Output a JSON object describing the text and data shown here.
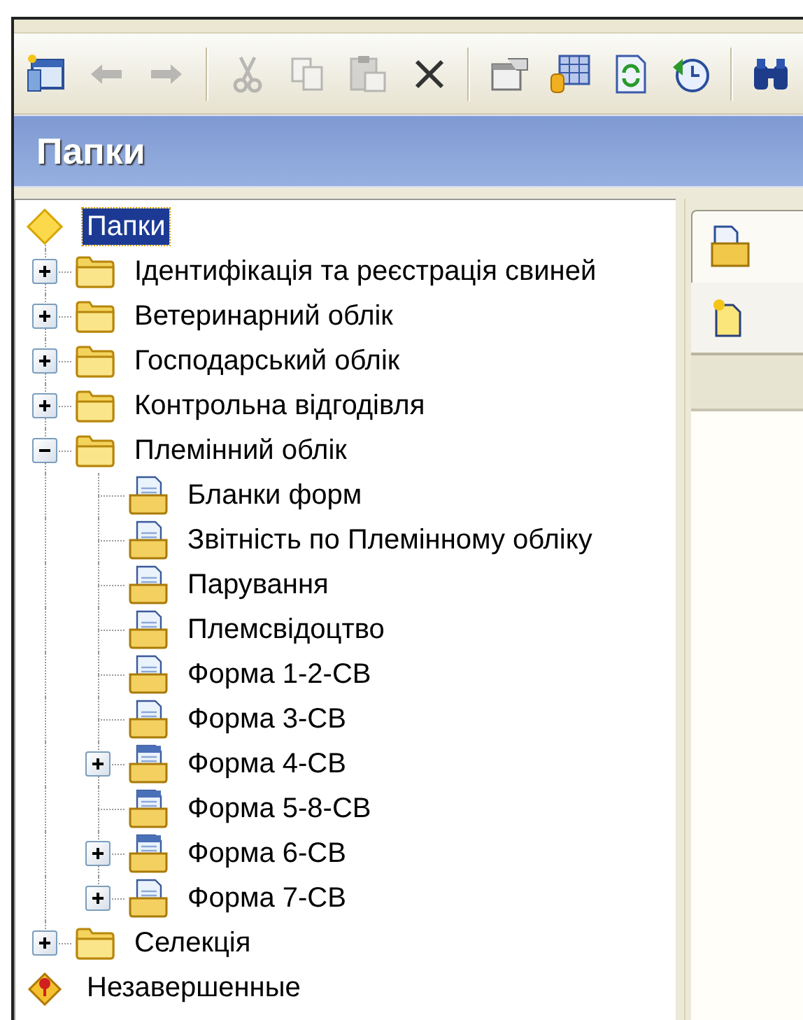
{
  "toolbar": [
    {
      "kind": "window",
      "disabled": false
    },
    {
      "kind": "back",
      "disabled": true
    },
    {
      "kind": "forward",
      "disabled": true
    },
    {
      "kind": "separator"
    },
    {
      "kind": "cut",
      "disabled": true
    },
    {
      "kind": "copy",
      "disabled": true
    },
    {
      "kind": "paste",
      "disabled": true
    },
    {
      "kind": "delete",
      "disabled": false
    },
    {
      "kind": "separator"
    },
    {
      "kind": "properties",
      "disabled": false
    },
    {
      "kind": "table",
      "disabled": false
    },
    {
      "kind": "refresh",
      "disabled": false
    },
    {
      "kind": "history",
      "disabled": false
    },
    {
      "kind": "separator"
    },
    {
      "kind": "find",
      "disabled": false
    }
  ],
  "panel": {
    "title": "Папки"
  },
  "tree": [
    {
      "kind": "root",
      "label": "Папки",
      "selected": true
    },
    {
      "kind": "folder",
      "label": "Ідентифікація та реєстрація свиней",
      "selected": false,
      "expanded": false
    },
    {
      "kind": "folder",
      "label": "Ветеринарний облік",
      "selected": false,
      "expanded": false
    },
    {
      "kind": "folder",
      "label": "Господарський облік",
      "selected": false,
      "expanded": false
    },
    {
      "kind": "folder",
      "label": "Контрольна відгодівля",
      "selected": false,
      "expanded": false
    },
    {
      "kind": "folder",
      "label": "Племінний облік",
      "selected": false,
      "expanded": true,
      "children": [
        {
          "kind": "report",
          "label": "Бланки форм",
          "selected": false
        },
        {
          "kind": "report",
          "label": "Звітність по Племінному обліку",
          "selected": false
        },
        {
          "kind": "report",
          "label": "Парування",
          "selected": false
        },
        {
          "kind": "report",
          "label": "Племсвідоцтво",
          "selected": false
        },
        {
          "kind": "report",
          "label": "Форма 1-2-СВ",
          "selected": false
        },
        {
          "kind": "report",
          "label": "Форма 3-СВ",
          "selected": false
        },
        {
          "kind": "form",
          "label": "Форма 4-СВ",
          "selected": false,
          "expanded": false
        },
        {
          "kind": "form",
          "label": "Форма 5-8-СВ",
          "selected": false
        },
        {
          "kind": "form",
          "label": "Форма 6-СВ",
          "selected": false,
          "expanded": false
        },
        {
          "kind": "report",
          "label": "Форма 7-СВ",
          "selected": false,
          "expanded": false
        }
      ]
    },
    {
      "kind": "folder",
      "label": "Селекція",
      "selected": false,
      "expanded": false
    },
    {
      "kind": "warning",
      "label": "Незавершенные",
      "selected": false
    }
  ],
  "right_panel": {
    "tab": {
      "kind": "folder",
      "selected": true
    },
    "button": {
      "kind": "new"
    }
  }
}
